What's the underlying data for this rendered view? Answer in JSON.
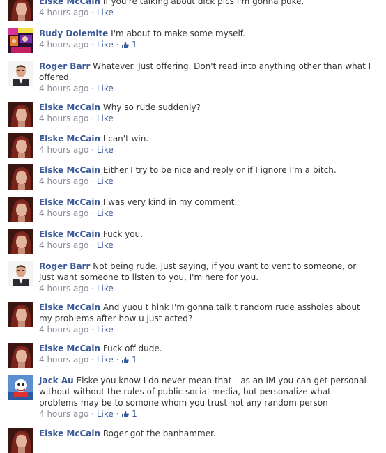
{
  "comments": [
    {
      "author": "Elske McCain",
      "text": "If you're talking about dick pics I'm gonna puke.",
      "time": "4 hours ago",
      "like": "Like",
      "likes": "",
      "avatar": "woman-avatar"
    },
    {
      "author": "Rudy Dolemite",
      "text": "I'm about to make some myself.",
      "time": "4 hours ago",
      "like": "Like",
      "likes": "1",
      "avatar": "collage-avatar"
    },
    {
      "author": "Roger Barr",
      "text": "Whatever. Just offering. Don't read into anything other than what I offered.",
      "time": "4 hours ago",
      "like": "Like",
      "likes": "",
      "avatar": "man-avatar"
    },
    {
      "author": "Elske McCain",
      "text": "Why so rude suddenly?",
      "time": "4 hours ago",
      "like": "Like",
      "likes": "",
      "avatar": "woman-avatar"
    },
    {
      "author": "Elske McCain",
      "text": "I can't win.",
      "time": "4 hours ago",
      "like": "Like",
      "likes": "",
      "avatar": "woman-avatar"
    },
    {
      "author": "Elske McCain",
      "text": "Either I try to be nice and reply or if I ignore I'm a bitch.",
      "time": "4 hours ago",
      "like": "Like",
      "likes": "",
      "avatar": "woman-avatar"
    },
    {
      "author": "Elske McCain",
      "text": "I was very kind in my comment.",
      "time": "4 hours ago",
      "like": "Like",
      "likes": "",
      "avatar": "woman-avatar"
    },
    {
      "author": "Elske McCain",
      "text": "Fuck you.",
      "time": "4 hours ago",
      "like": "Like",
      "likes": "",
      "avatar": "woman-avatar"
    },
    {
      "author": "Roger Barr",
      "text": "Not being rude. Just saying, if you want to vent to someone, or just want someone to listen to you, I'm here for you.",
      "time": "4 hours ago",
      "like": "Like",
      "likes": "",
      "avatar": "man-avatar"
    },
    {
      "author": "Elske McCain",
      "text": "And yuou t hink I'm gonna talk t random rude assholes about my problems after how u just acted?",
      "time": "4 hours ago",
      "like": "Like",
      "likes": "",
      "avatar": "woman-avatar"
    },
    {
      "author": "Elske McCain",
      "text": "Fuck off dude.",
      "time": "4 hours ago",
      "like": "Like",
      "likes": "1",
      "avatar": "woman-avatar"
    },
    {
      "author": "Jack Au",
      "text": "Elske you know I do never mean that---as an IM you can get personal without without the rules of public social media, but personalize what problems may be to somone whom you trust not any random person",
      "time": "4 hours ago",
      "like": "Like",
      "likes": "1",
      "avatar": "cartoon-avatar"
    },
    {
      "author": "Elske McCain",
      "text": "Roger got the banhammer.",
      "time": "",
      "like": "",
      "likes": "",
      "avatar": "woman-avatar"
    }
  ],
  "colors": {
    "link": "#3b5998",
    "meta": "#898f9c",
    "text": "#333333"
  },
  "separator": "·"
}
